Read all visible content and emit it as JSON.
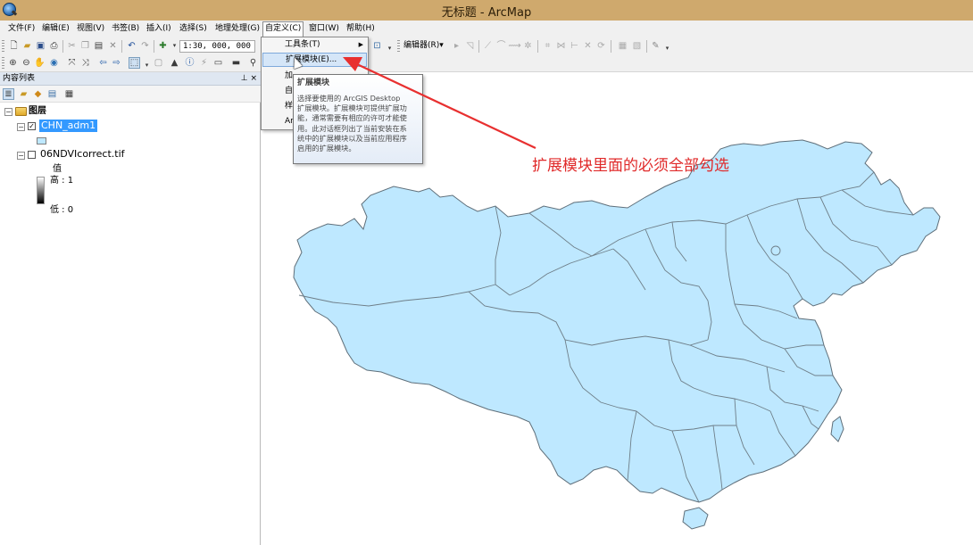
{
  "window": {
    "title": "无标题 - ArcMap"
  },
  "menubar": {
    "file": "文件(F)",
    "edit": "编辑(E)",
    "view": "视图(V)",
    "bookmarks": "书签(B)",
    "insert": "插入(I)",
    "selection": "选择(S)",
    "geoprocessing": "地理处理(G)",
    "customize": "自定义(C)",
    "windows": "窗口(W)",
    "help": "帮助(H)"
  },
  "toolbar": {
    "scale_value": "1:30, 000, 000",
    "editor_label": "编辑器(R)▾"
  },
  "toc": {
    "title": "内容列表",
    "controls": "⊥ ×",
    "layers_group": "图层",
    "layers": [
      {
        "name": "CHN_adm1",
        "checked": true,
        "selected": true
      },
      {
        "name": "06NDVIcorrect.tif",
        "checked": false,
        "selected": false
      }
    ],
    "raster_legend": {
      "header": "值",
      "high": "高 : 1",
      "low": "低 : 0"
    }
  },
  "customize_menu": {
    "items": [
      {
        "label": "工具条(T)",
        "submenu": true
      },
      {
        "label": "扩展模块(E)...",
        "highlighted": true
      },
      {
        "label": "加",
        "highlighted": false
      },
      {
        "label": "自",
        "highlighted": false
      },
      {
        "label": "样",
        "highlighted": false
      },
      {
        "label": "Ar",
        "highlighted": false
      }
    ]
  },
  "tooltip": {
    "title": "扩展模块",
    "lines": [
      "选择要使用的 ArcGIS Desktop",
      "扩展模块。扩展模块可提供扩展功",
      "能，通常需要有相应的许可才能使",
      "用。此对话框列出了当前安装在系",
      "统中的扩展模块以及当前应用程序",
      "启用的扩展模块。"
    ]
  },
  "annotation": {
    "text": "扩展模块里面的必须全部勾选"
  },
  "colors": {
    "titlebar": "#cfa96d",
    "map_fill": "#bee8ff",
    "map_border": "#5f6f7a",
    "annotation": "#e02a2a",
    "selection": "#3399ff"
  },
  "icons": [
    "app-globe-icon",
    "new-icon",
    "open-icon",
    "save-icon",
    "print-icon",
    "cut-icon",
    "copy-icon",
    "paste-icon",
    "delete-icon",
    "undo-icon",
    "redo-icon",
    "add-data-icon",
    "zoom-in-icon",
    "zoom-out-icon",
    "pan-icon",
    "full-extent-icon",
    "back-icon",
    "forward-icon",
    "select-features-icon",
    "identify-icon",
    "find-icon",
    "measure-icon",
    "list-by-drawing-order-icon",
    "list-by-source-icon",
    "list-by-visibility-icon",
    "list-by-selection-icon",
    "options-icon",
    "cursor-icon"
  ]
}
